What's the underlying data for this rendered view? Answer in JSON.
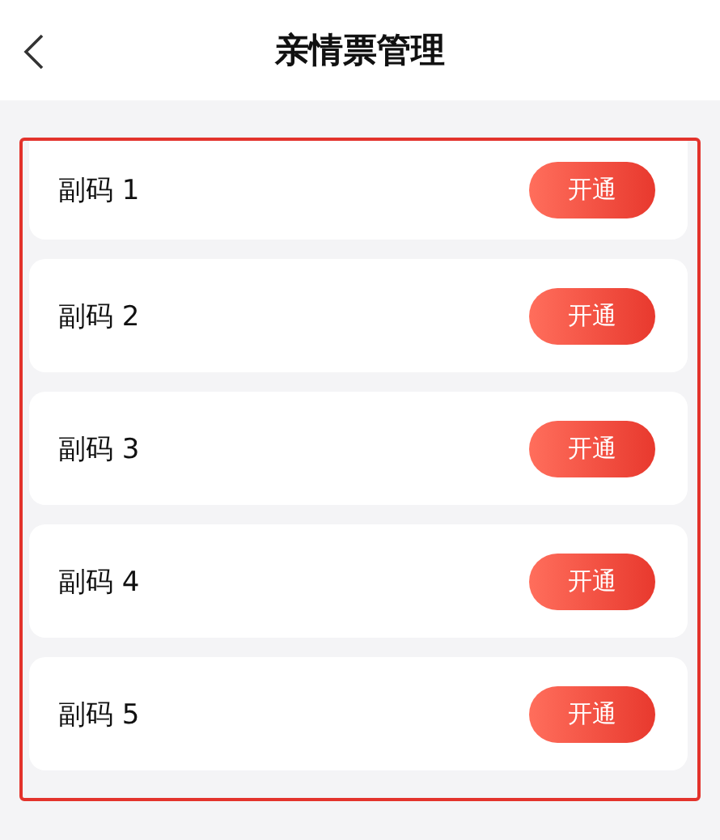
{
  "header": {
    "title": "亲情票管理"
  },
  "items": [
    {
      "label": "副码 1",
      "button": "开通"
    },
    {
      "label": "副码 2",
      "button": "开通"
    },
    {
      "label": "副码 3",
      "button": "开通"
    },
    {
      "label": "副码 4",
      "button": "开通"
    },
    {
      "label": "副码 5",
      "button": "开通"
    }
  ]
}
